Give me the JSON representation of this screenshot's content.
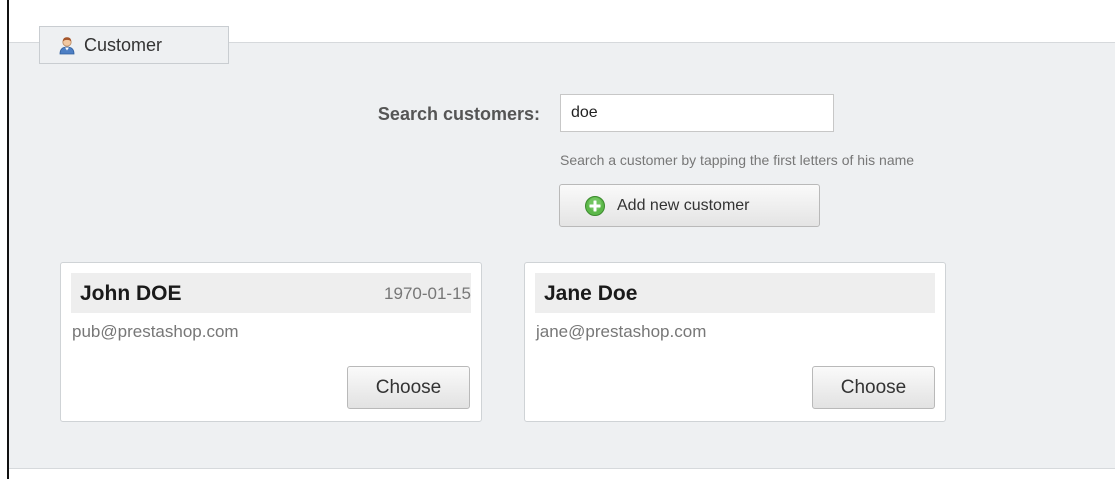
{
  "fieldset": {
    "legend": "Customer",
    "legend_icon": "customer-icon"
  },
  "search": {
    "label": "Search customers:",
    "value": "doe",
    "hint": "Search a customer by tapping the first letters of his name"
  },
  "add_button": {
    "label": "Add new customer",
    "icon": "plus-circle-icon",
    "icon_color": "#4aa63c"
  },
  "customers": [
    {
      "name": "John DOE",
      "birthday": "1970-01-15",
      "email": "pub@prestashop.com",
      "choose_label": "Choose"
    },
    {
      "name": "Jane Doe",
      "birthday": "",
      "email": "jane@prestashop.com",
      "choose_label": "Choose"
    }
  ],
  "colors": {
    "panel_background": "#eef0f2",
    "card_header": "#eeeeee",
    "muted_text": "#777777"
  }
}
